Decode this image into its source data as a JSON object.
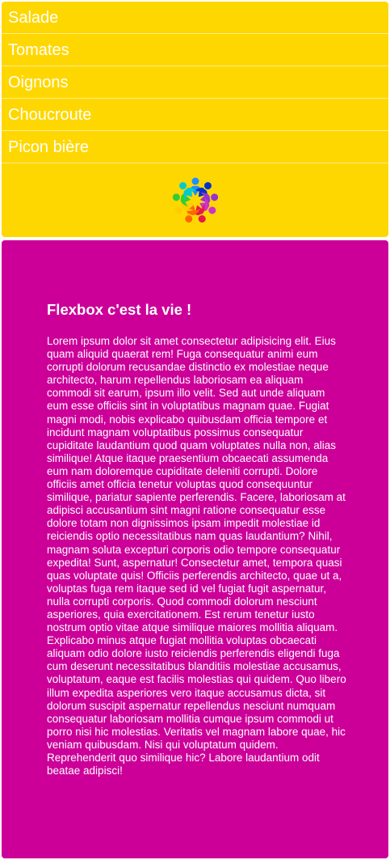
{
  "nav": {
    "items": [
      {
        "label": "Salade"
      },
      {
        "label": "Tomates"
      },
      {
        "label": "Oignons"
      },
      {
        "label": "Choucroute"
      },
      {
        "label": "Picon bière"
      }
    ],
    "logo_icon": "people-circle-logo-icon"
  },
  "colors": {
    "nav_background": "#ffd700",
    "content_background": "#cc0099",
    "text": "#ffffff"
  },
  "article": {
    "title": "Flexbox c'est la vie !",
    "body": "Lorem ipsum dolor sit amet consectetur adipisicing elit. Eius quam aliquid quaerat rem! Fuga consequatur animi eum corrupti dolorum recusandae distinctio ex molestiae neque architecto, harum repellendus laboriosam ea aliquam commodi sit earum, ipsum illo velit. Sed aut unde aliquam eum esse officiis sint in voluptatibus magnam quae. Fugiat magni modi, nobis explicabo quibusdam officia tempore et incidunt magnam voluptatibus possimus consequatur cupiditate laudantium quod quam voluptates nulla non, alias similique! Atque itaque praesentium obcaecati assumenda eum nam doloremque cupiditate deleniti corrupti. Dolore officiis amet officia tenetur voluptas quod consequuntur similique, pariatur sapiente perferendis. Facere, laboriosam at adipisci accusantium sint magni ratione consequatur esse dolore totam non dignissimos ipsam impedit molestiae id reiciendis optio necessitatibus nam quas laudantium? Nihil, magnam soluta excepturi corporis odio tempore consequatur expedita! Sunt, aspernatur! Consectetur amet, tempora quasi quas voluptate quis! Officiis perferendis architecto, quae ut a, voluptas fuga rem itaque sed id vel fugiat fugit aspernatur, nulla corrupti corporis. Quod commodi dolorum nesciunt asperiores, quia exercitationem. Est rerum tenetur iusto nostrum optio vitae atque similique maiores mollitia aliquam. Explicabo minus atque fugiat mollitia voluptas obcaecati aliquam odio dolore iusto reiciendis perferendis eligendi fuga cum deserunt necessitatibus blanditiis molestiae accusamus, voluptatum, eaque est facilis molestias qui quidem. Quo libero illum expedita asperiores vero itaque accusamus dicta, sit dolorum suscipit aspernatur repellendus nesciunt numquam consequatur laboriosam mollitia cumque ipsum commodi ut porro nisi hic molestias. Veritatis vel magnam labore quae, hic veniam quibusdam. Nisi qui voluptatum quidem. Reprehenderit quo similique hic? Labore laudantium odit beatae adipisci!"
  }
}
